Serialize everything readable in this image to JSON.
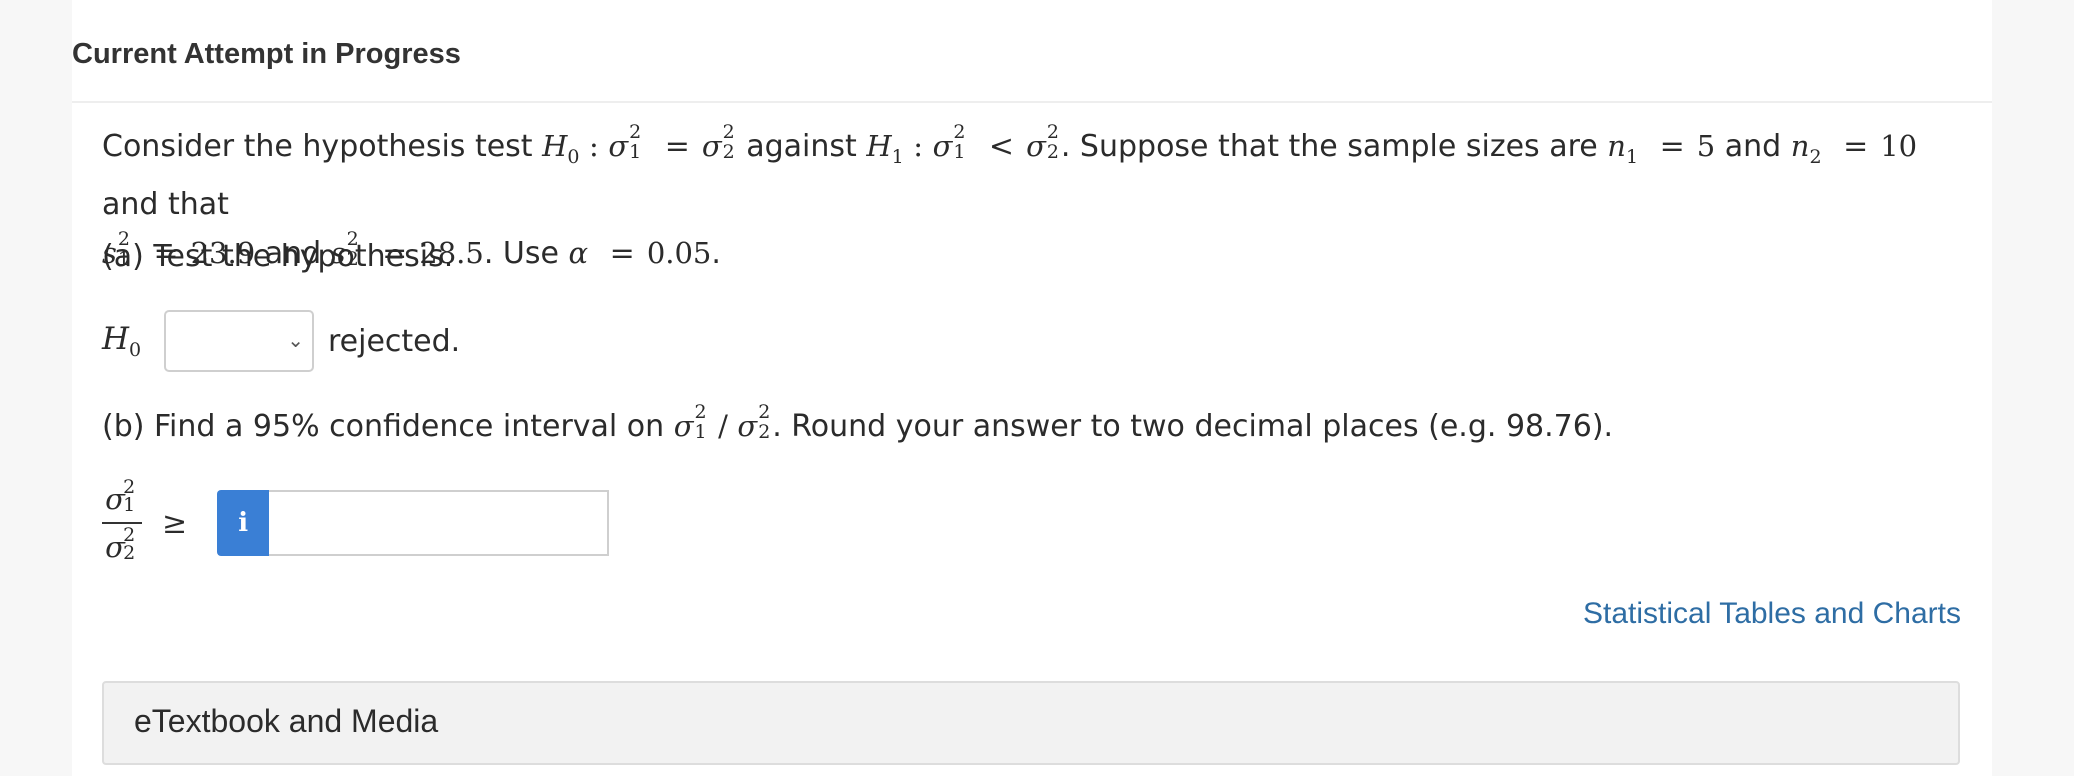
{
  "header": {
    "title": "Current Attempt in Progress"
  },
  "question": {
    "t_consider": "Consider the hypothesis test",
    "t_against": "against",
    "t_sample": ". Suppose that the sample sizes are",
    "t_and": "and",
    "t_and_that": "and that",
    "t_and2": "and",
    "t_use": ". Use",
    "t_end": ".",
    "H": "H",
    "sigma": "σ",
    "s": "s",
    "n": "n",
    "alpha": "α",
    "sub0": "0",
    "sub1": "1",
    "sub2": "2",
    "sq": "2",
    "colon": ":",
    "eq": "=",
    "lt": "<",
    "n1_value": "5",
    "n2_value": "10",
    "s1_value": "23.9",
    "s2_value": "28.5",
    "alpha_value": "0.05"
  },
  "part_a": {
    "label": "(a) Test the hypothesis.",
    "h0_label": "H",
    "h0_sub": "0",
    "select_value": "",
    "rejected_text": "rejected."
  },
  "part_b": {
    "prefix": "(b) Find a 95% confidence interval on",
    "slash": "/",
    "suffix": ". Round your answer to two decimal places (e.g. 98.76).",
    "geq": "≥",
    "info_glyph": "i",
    "answer_value": ""
  },
  "links": {
    "stat_tables": "Statistical Tables and Charts"
  },
  "etextbook": {
    "label": "eTextbook and Media"
  },
  "icons": {
    "dropdown": "chevron-down-icon",
    "info": "info-icon"
  },
  "colors": {
    "info_button": "#3a7fd5",
    "link": "#2e6da4"
  }
}
